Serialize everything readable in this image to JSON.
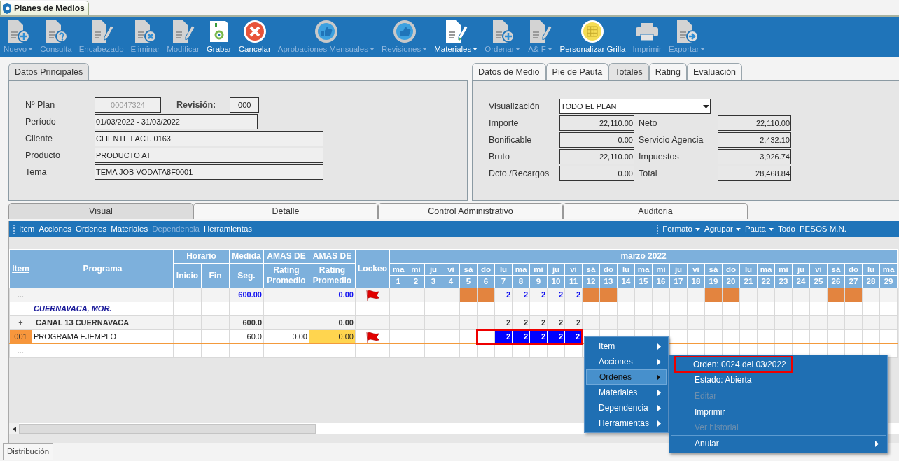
{
  "app_tab": {
    "title": "Planes de Medios"
  },
  "toolbar": [
    {
      "label": "Nuevo",
      "enabled": false,
      "dropdown": true
    },
    {
      "label": "Consulta",
      "enabled": false,
      "dropdown": false
    },
    {
      "label": "Encabezado",
      "enabled": false,
      "dropdown": false
    },
    {
      "label": "Eliminar",
      "enabled": false,
      "dropdown": false
    },
    {
      "label": "Modificar",
      "enabled": false,
      "dropdown": false
    },
    {
      "label": "Grabar",
      "enabled": true,
      "dropdown": false
    },
    {
      "label": "Cancelar",
      "enabled": true,
      "dropdown": false
    },
    {
      "label": "Aprobaciones Mensuales",
      "enabled": false,
      "dropdown": true
    },
    {
      "label": "Revisiones",
      "enabled": false,
      "dropdown": true
    },
    {
      "label": "Materiales",
      "enabled": true,
      "dropdown": true
    },
    {
      "label": "Ordenar",
      "enabled": false,
      "dropdown": true
    },
    {
      "label": "A& F",
      "enabled": false,
      "dropdown": true
    },
    {
      "label": "Personalizar Grilla",
      "enabled": true,
      "dropdown": false
    },
    {
      "label": "Imprimir",
      "enabled": false,
      "dropdown": false
    },
    {
      "label": "Exportar",
      "enabled": false,
      "dropdown": true
    }
  ],
  "main_panel": {
    "tabs": [
      {
        "label": "Datos Principales",
        "selected": true
      }
    ],
    "plan": {
      "label": "Nº Plan",
      "value": "00047324",
      "disabled": true
    },
    "revision": {
      "label": "Revisión:",
      "value": "000"
    },
    "fields": [
      {
        "label": "Período",
        "value": "01/03/2022 - 31/03/2022",
        "kind": "range"
      },
      {
        "label": "Cliente",
        "value": "CLIENTE FACT. 0163",
        "kind": "text"
      },
      {
        "label": "Producto",
        "value": "PRODUCTO AT",
        "kind": "text"
      },
      {
        "label": "Tema",
        "value": "TEMA JOB VODATA8F0001",
        "kind": "text"
      }
    ]
  },
  "totals_panel": {
    "tabs": [
      {
        "label": "Datos de Medio",
        "selected": false
      },
      {
        "label": "Pie de Pauta",
        "selected": false
      },
      {
        "label": "Totales",
        "selected": true
      },
      {
        "label": "Rating",
        "selected": false
      },
      {
        "label": "Evaluación",
        "selected": false
      }
    ],
    "view": {
      "label": "Visualización",
      "value": "TODO EL PLAN"
    },
    "rows": [
      {
        "label": "Importe",
        "value": "22,110.00",
        "label2": "Neto",
        "value2": "22,110.00"
      },
      {
        "label": "Bonificable",
        "value": "0.00",
        "label2": "Servicio Agencia",
        "value2": "2,432.10"
      },
      {
        "label": "Bruto",
        "value": "22,110.00",
        "label2": "Impuestos",
        "value2": "3,926.74"
      },
      {
        "label": "Dcto./Recargos",
        "value": "0.00",
        "label2": "Total",
        "value2": "28,468.84"
      }
    ]
  },
  "grid_tabs": [
    {
      "label": "Visual",
      "selected": true
    },
    {
      "label": "Detalle",
      "selected": false
    },
    {
      "label": "Control Administrativo",
      "selected": false
    },
    {
      "label": "Auditoria",
      "selected": false
    }
  ],
  "grid_toolbar": {
    "left": [
      {
        "label": "Item",
        "enabled": true
      },
      {
        "label": "Acciones",
        "enabled": true
      },
      {
        "label": "Ordenes",
        "enabled": true
      },
      {
        "label": "Materiales",
        "enabled": true
      },
      {
        "label": "Dependencia",
        "enabled": false
      },
      {
        "label": "Herramientas",
        "enabled": true
      }
    ],
    "right": [
      {
        "label": "Formato",
        "dropdown": true
      },
      {
        "label": "Agrupar",
        "dropdown": true
      },
      {
        "label": "Pauta",
        "dropdown": true
      },
      {
        "label": "Todo",
        "dropdown": false
      },
      {
        "label": "PESOS M.N.",
        "dropdown": false
      }
    ]
  },
  "grid": {
    "columns": [
      {
        "title": "Item",
        "kind": "link"
      },
      {
        "title": "Programa",
        "kind": "plain"
      },
      {
        "title": "Horario",
        "kind": "group",
        "children": [
          {
            "title": "Inicio"
          },
          {
            "title": "Fin"
          }
        ]
      },
      {
        "title": "Medida",
        "kind": "sub",
        "sub": "Seg."
      },
      {
        "title": "AMAS DE",
        "kind": "sub",
        "sub": "Rating Promedio"
      },
      {
        "title": "AMAS DE",
        "kind": "sub",
        "sub": "Rating Promedio"
      },
      {
        "title": "Lockeo",
        "kind": "plain"
      }
    ],
    "month": "marzo 2022",
    "days": [
      {
        "name": "ma",
        "number": "1",
        "weekend": false
      },
      {
        "name": "mi",
        "number": "2",
        "weekend": false
      },
      {
        "name": "ju",
        "number": "3",
        "weekend": false
      },
      {
        "name": "vi",
        "number": "4",
        "weekend": false
      },
      {
        "name": "sá",
        "number": "5",
        "weekend": true
      },
      {
        "name": "do",
        "number": "6",
        "weekend": true
      },
      {
        "name": "lu",
        "number": "7",
        "weekend": false
      },
      {
        "name": "ma",
        "number": "8",
        "weekend": false
      },
      {
        "name": "mi",
        "number": "9",
        "weekend": false
      },
      {
        "name": "ju",
        "number": "10",
        "weekend": false
      },
      {
        "name": "vi",
        "number": "11",
        "weekend": false
      },
      {
        "name": "sá",
        "number": "12",
        "weekend": true
      },
      {
        "name": "do",
        "number": "13",
        "weekend": true
      },
      {
        "name": "lu",
        "number": "14",
        "weekend": false
      },
      {
        "name": "ma",
        "number": "15",
        "weekend": false
      },
      {
        "name": "mi",
        "number": "16",
        "weekend": false
      },
      {
        "name": "ju",
        "number": "17",
        "weekend": false
      },
      {
        "name": "vi",
        "number": "18",
        "weekend": false
      },
      {
        "name": "sá",
        "number": "19",
        "weekend": true
      },
      {
        "name": "do",
        "number": "20",
        "weekend": true
      },
      {
        "name": "lu",
        "number": "21",
        "weekend": false
      },
      {
        "name": "ma",
        "number": "22",
        "weekend": false
      },
      {
        "name": "mi",
        "number": "23",
        "weekend": false
      },
      {
        "name": "ju",
        "number": "24",
        "weekend": false
      },
      {
        "name": "vi",
        "number": "25",
        "weekend": false
      },
      {
        "name": "sá",
        "number": "26",
        "weekend": true
      },
      {
        "name": "do",
        "number": "27",
        "weekend": true
      },
      {
        "name": "lu",
        "number": "28",
        "weekend": false
      },
      {
        "name": "ma",
        "number": "29",
        "weekend": false
      }
    ],
    "rows": [
      {
        "kind": "total",
        "item": "...",
        "cells": [
          null,
          null,
          null,
          "600.00",
          null,
          "0.00"
        ],
        "flag": true,
        "selected": false,
        "framed": false,
        "days": [
          {
            "selected": false
          },
          {
            "selected": false
          },
          {
            "selected": false
          },
          {
            "selected": false
          },
          {
            "selected": false
          },
          {
            "selected": false
          },
          {
            "value": "2",
            "selected": false
          },
          {
            "value": "2",
            "selected": false
          },
          {
            "value": "2",
            "selected": false
          },
          {
            "value": "2",
            "selected": false
          },
          {
            "value": "2",
            "selected": false
          },
          {
            "selected": false
          },
          {
            "selected": false
          },
          {
            "selected": false
          },
          {
            "selected": false
          },
          {
            "selected": false
          },
          {
            "selected": false
          },
          {
            "selected": false
          },
          {
            "selected": false
          },
          {
            "selected": false
          },
          {
            "selected": false
          },
          {
            "selected": false
          },
          {
            "selected": false
          },
          {
            "selected": false
          },
          {
            "selected": false
          },
          {
            "selected": false
          },
          {
            "selected": false
          },
          {
            "selected": false
          },
          {
            "selected": false
          }
        ]
      },
      {
        "kind": "group",
        "cells": [
          "CUERNAVACA, MOR.",
          null,
          null,
          null,
          null,
          null
        ],
        "flag": false,
        "selected": false,
        "framed": false
      },
      {
        "kind": "channel",
        "item": "+",
        "cells": [
          "CANAL 13 CUERNAVACA",
          null,
          null,
          "600.0",
          null,
          "0.00"
        ],
        "flag": false,
        "selected": false,
        "framed": false,
        "days": [
          {
            "selected": false
          },
          {
            "selected": false
          },
          {
            "selected": false
          },
          {
            "selected": false
          },
          {
            "selected": false
          },
          {
            "selected": false
          },
          {
            "value": "2",
            "selected": false
          },
          {
            "value": "2",
            "selected": false
          },
          {
            "value": "2",
            "selected": false
          },
          {
            "value": "2",
            "selected": false
          },
          {
            "value": "2",
            "selected": false
          },
          {
            "selected": false
          },
          {
            "selected": false
          },
          {
            "selected": false
          },
          {
            "selected": false
          },
          {
            "selected": false
          },
          {
            "selected": false
          },
          {
            "selected": false
          },
          {
            "selected": false
          },
          {
            "selected": false
          },
          {
            "selected": false
          },
          {
            "selected": false
          },
          {
            "selected": false
          },
          {
            "selected": false
          },
          {
            "selected": false
          },
          {
            "selected": false
          },
          {
            "selected": false
          },
          {
            "selected": false
          },
          {
            "selected": false
          }
        ]
      },
      {
        "kind": "item",
        "item": "001",
        "cells": [
          "PROGRAMA EJEMPLO",
          null,
          null,
          "60.0",
          "0.00",
          {
            "text": "0.00",
            "highlighted": true
          }
        ],
        "flag": true,
        "selected": true,
        "framed": true,
        "days": [
          {
            "selected": false
          },
          {
            "selected": false
          },
          {
            "selected": false
          },
          {
            "selected": false
          },
          {
            "selected": false
          },
          {
            "selected": false
          },
          {
            "value": "2",
            "selected": true
          },
          {
            "value": "2",
            "selected": true
          },
          {
            "value": "2",
            "selected": true
          },
          {
            "value": "2",
            "selected": true
          },
          {
            "value": "2",
            "selected": true
          },
          {
            "selected": false
          },
          {
            "selected": false
          },
          {
            "selected": false
          },
          {
            "selected": false
          },
          {
            "selected": false
          },
          {
            "selected": false
          },
          {
            "selected": false
          },
          {
            "selected": false
          },
          {
            "selected": false
          },
          {
            "selected": false
          },
          {
            "selected": false
          },
          {
            "selected": false
          },
          {
            "selected": false
          },
          {
            "selected": false
          },
          {
            "selected": false
          },
          {
            "selected": false
          },
          {
            "selected": false
          },
          {
            "selected": false
          }
        ]
      },
      {
        "kind": "blank",
        "item": "...",
        "cells": [
          null,
          null,
          null,
          null,
          null,
          null
        ],
        "flag": false,
        "selected": false,
        "framed": false
      }
    ]
  },
  "context_menu": {
    "items": [
      {
        "label": "Item",
        "selected": false
      },
      {
        "label": "Acciones",
        "selected": false
      },
      {
        "label": "Ordenes",
        "selected": true
      },
      {
        "label": "Materiales",
        "selected": false
      },
      {
        "label": "Dependencia",
        "selected": false
      },
      {
        "label": "Herramientas",
        "selected": false
      }
    ],
    "submenu": [
      {
        "label": "Orden: 0024 del 03/2022",
        "disabled": false,
        "framed": true,
        "separator_before": false,
        "has_submenu": false
      },
      {
        "label": "Estado: Abierta",
        "disabled": false,
        "framed": false,
        "separator_before": false,
        "has_submenu": false
      },
      {
        "label": "Editar",
        "disabled": true,
        "framed": false,
        "separator_before": true,
        "has_submenu": false
      },
      {
        "label": "Imprimir",
        "disabled": false,
        "framed": false,
        "separator_before": true,
        "has_submenu": false
      },
      {
        "label": "Ver historial",
        "disabled": true,
        "framed": false,
        "separator_before": false,
        "has_submenu": false
      },
      {
        "label": "Anular",
        "disabled": false,
        "framed": false,
        "separator_before": true,
        "has_submenu": true
      }
    ]
  },
  "bottom_tab": {
    "label": "Distribución"
  }
}
